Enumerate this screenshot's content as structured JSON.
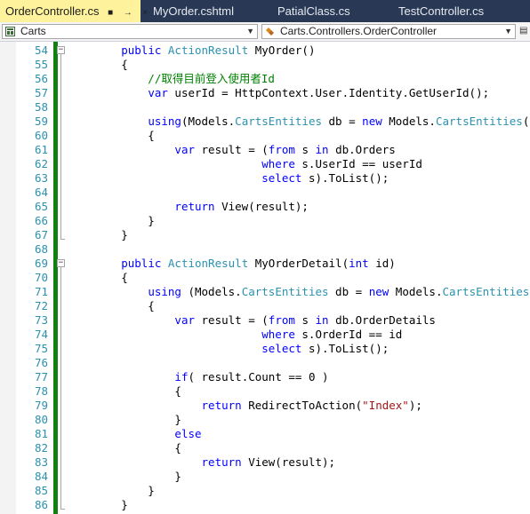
{
  "tabs": [
    {
      "label": "OrderController.cs",
      "pin": "⬚",
      "close": "→"
    },
    {
      "label": "MyOrder.cshtml",
      "close": "×"
    },
    {
      "label": "PatialClass.cs",
      "close": "×"
    },
    {
      "label": "TestController.cs",
      "close": "×"
    }
  ],
  "nav": {
    "project": "Carts",
    "member": "Carts.Controllers.OrderController"
  },
  "lines": [
    {
      "n": "54",
      "t": [
        [
          "        ",
          ""
        ],
        [
          "public ",
          "kw"
        ],
        [
          "ActionResult ",
          "ty"
        ],
        [
          "MyOrder()",
          ""
        ]
      ]
    },
    {
      "n": "55",
      "t": [
        [
          "        {",
          ""
        ]
      ]
    },
    {
      "n": "56",
      "t": [
        [
          "            //取得目前登入使用者Id",
          "cm"
        ]
      ]
    },
    {
      "n": "57",
      "t": [
        [
          "            ",
          ""
        ],
        [
          "var ",
          "kw"
        ],
        [
          "userId = HttpContext.User.Identity.GetUserId();",
          ""
        ]
      ]
    },
    {
      "n": "58",
      "t": [
        [
          "",
          ""
        ]
      ]
    },
    {
      "n": "59",
      "t": [
        [
          "            ",
          ""
        ],
        [
          "using",
          "kw"
        ],
        [
          "(Models.",
          ""
        ],
        [
          "CartsEntities ",
          "ty"
        ],
        [
          "db = ",
          ""
        ],
        [
          "new ",
          "kw"
        ],
        [
          "Models.",
          ""
        ],
        [
          "CartsEntities",
          "ty"
        ],
        [
          "())",
          ""
        ]
      ]
    },
    {
      "n": "60",
      "t": [
        [
          "            {",
          ""
        ]
      ]
    },
    {
      "n": "61",
      "t": [
        [
          "                ",
          ""
        ],
        [
          "var ",
          "kw"
        ],
        [
          "result = (",
          ""
        ],
        [
          "from ",
          "kw"
        ],
        [
          "s ",
          ""
        ],
        [
          "in ",
          "kw"
        ],
        [
          "db.Orders",
          ""
        ]
      ]
    },
    {
      "n": "62",
      "t": [
        [
          "                             ",
          ""
        ],
        [
          "where ",
          "kw"
        ],
        [
          "s.UserId == userId",
          ""
        ]
      ]
    },
    {
      "n": "63",
      "t": [
        [
          "                             ",
          ""
        ],
        [
          "select ",
          "kw"
        ],
        [
          "s).ToList();",
          ""
        ]
      ]
    },
    {
      "n": "64",
      "t": [
        [
          "",
          ""
        ]
      ]
    },
    {
      "n": "65",
      "t": [
        [
          "                ",
          ""
        ],
        [
          "return ",
          "kw"
        ],
        [
          "View(result);",
          ""
        ]
      ]
    },
    {
      "n": "66",
      "t": [
        [
          "            }",
          ""
        ]
      ]
    },
    {
      "n": "67",
      "t": [
        [
          "        }",
          ""
        ]
      ]
    },
    {
      "n": "68",
      "t": [
        [
          "",
          ""
        ]
      ]
    },
    {
      "n": "69",
      "t": [
        [
          "        ",
          ""
        ],
        [
          "public ",
          "kw"
        ],
        [
          "ActionResult ",
          "ty"
        ],
        [
          "MyOrderDetail(",
          ""
        ],
        [
          "int ",
          "kw"
        ],
        [
          "id)",
          ""
        ]
      ]
    },
    {
      "n": "70",
      "t": [
        [
          "        {",
          ""
        ]
      ]
    },
    {
      "n": "71",
      "t": [
        [
          "            ",
          ""
        ],
        [
          "using ",
          "kw"
        ],
        [
          "(Models.",
          ""
        ],
        [
          "CartsEntities ",
          "ty"
        ],
        [
          "db = ",
          ""
        ],
        [
          "new ",
          "kw"
        ],
        [
          "Models.",
          ""
        ],
        [
          "CartsEntities",
          "ty"
        ],
        [
          "())",
          ""
        ]
      ]
    },
    {
      "n": "72",
      "t": [
        [
          "            {",
          ""
        ]
      ]
    },
    {
      "n": "73",
      "t": [
        [
          "                ",
          ""
        ],
        [
          "var ",
          "kw"
        ],
        [
          "result = (",
          ""
        ],
        [
          "from ",
          "kw"
        ],
        [
          "s ",
          ""
        ],
        [
          "in ",
          "kw"
        ],
        [
          "db.OrderDetails",
          ""
        ]
      ]
    },
    {
      "n": "74",
      "t": [
        [
          "                             ",
          ""
        ],
        [
          "where ",
          "kw"
        ],
        [
          "s.OrderId == id",
          ""
        ]
      ]
    },
    {
      "n": "75",
      "t": [
        [
          "                             ",
          ""
        ],
        [
          "select ",
          "kw"
        ],
        [
          "s).ToList();",
          ""
        ]
      ]
    },
    {
      "n": "76",
      "t": [
        [
          "",
          ""
        ]
      ]
    },
    {
      "n": "77",
      "t": [
        [
          "                ",
          ""
        ],
        [
          "if",
          "kw"
        ],
        [
          "( result.Count == 0 )",
          ""
        ]
      ]
    },
    {
      "n": "78",
      "t": [
        [
          "                {",
          ""
        ]
      ]
    },
    {
      "n": "79",
      "t": [
        [
          "                    ",
          ""
        ],
        [
          "return ",
          "kw"
        ],
        [
          "RedirectToAction(",
          ""
        ],
        [
          "\"Index\"",
          "st"
        ],
        [
          ");",
          ""
        ]
      ]
    },
    {
      "n": "80",
      "t": [
        [
          "                }",
          ""
        ]
      ]
    },
    {
      "n": "81",
      "t": [
        [
          "                ",
          ""
        ],
        [
          "else",
          "kw"
        ]
      ]
    },
    {
      "n": "82",
      "t": [
        [
          "                {",
          ""
        ]
      ]
    },
    {
      "n": "83",
      "t": [
        [
          "                    ",
          ""
        ],
        [
          "return ",
          "kw"
        ],
        [
          "View(result);",
          ""
        ]
      ]
    },
    {
      "n": "84",
      "t": [
        [
          "                }",
          ""
        ]
      ]
    },
    {
      "n": "85",
      "t": [
        [
          "            }",
          ""
        ]
      ]
    },
    {
      "n": "86",
      "t": [
        [
          "        }",
          ""
        ]
      ]
    }
  ],
  "folds": [
    {
      "line": "54",
      "sign": "−"
    },
    {
      "line": "69",
      "sign": "−"
    }
  ],
  "colors": {
    "keyword": "#0000ff",
    "type": "#2b91af",
    "comment": "#008000",
    "string": "#a31515",
    "line_number": "#2b91af",
    "changed_bar": "#108010",
    "active_tab": "#fff29d",
    "tab_strip": "#293955"
  },
  "icons": {
    "project": "csharp-project-icon",
    "member": "class-member-icon"
  }
}
